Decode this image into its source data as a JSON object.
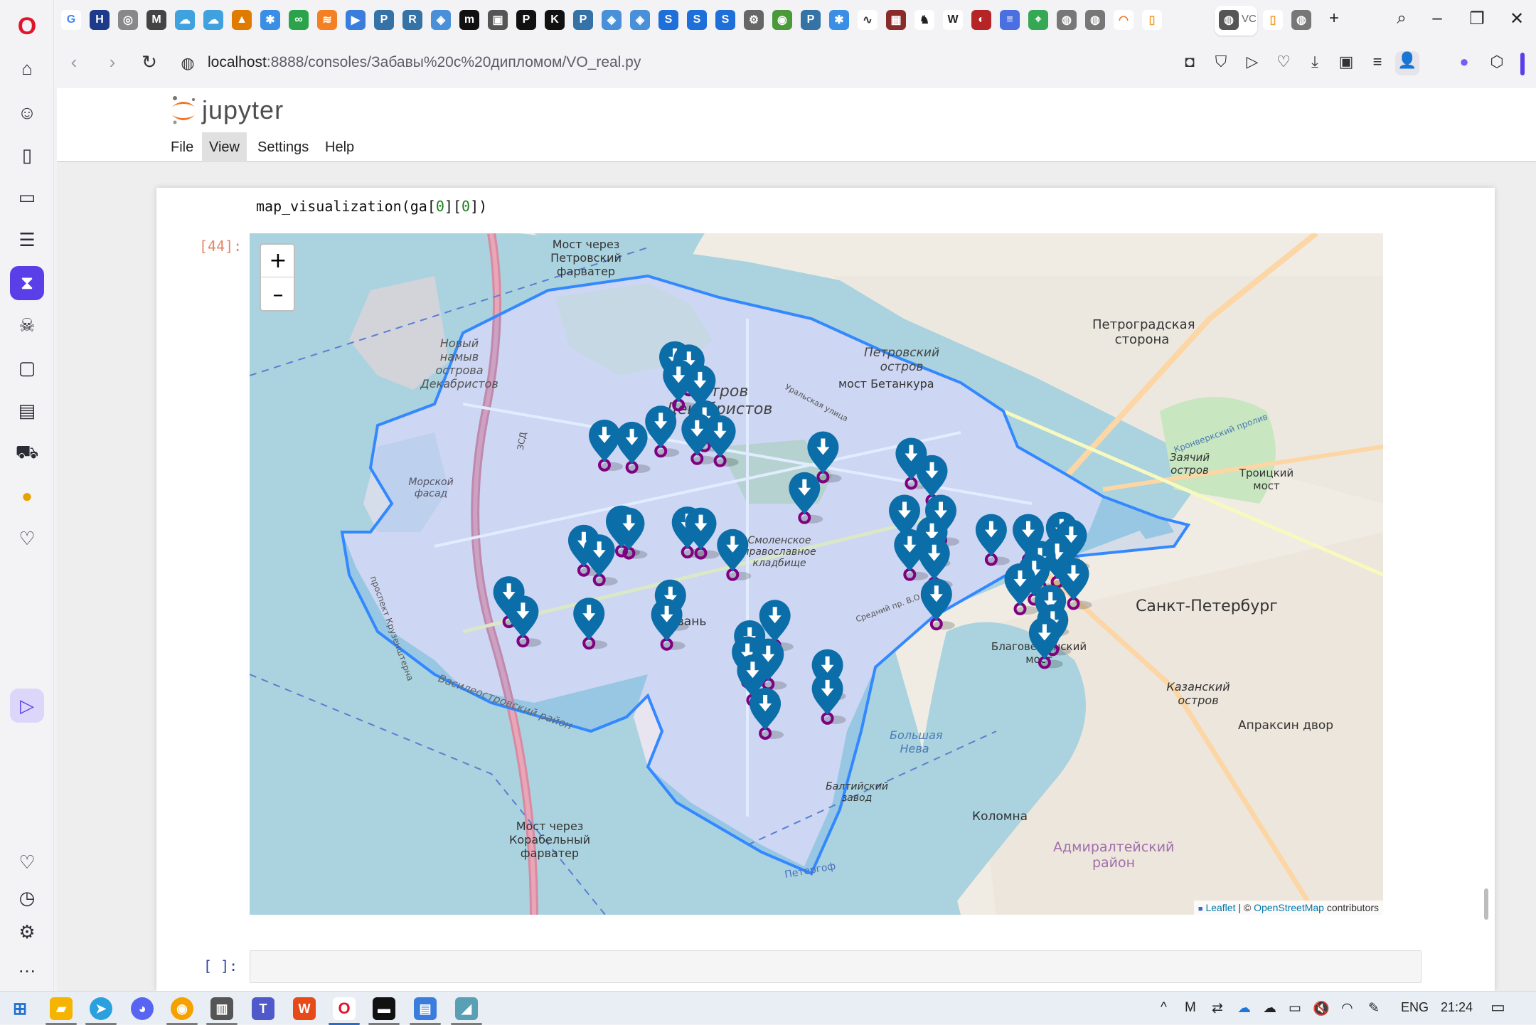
{
  "browser": {
    "url_host": "localhost",
    "url_path": ":8888/consoles/Забавы%20с%20дипломом/VO_real.py",
    "active_tab_label": "VC"
  },
  "jupyter": {
    "logo_text": "jupyter",
    "menu": [
      "File",
      "View",
      "Settings",
      "Help"
    ],
    "code_prefix": "map_visualization(ga[",
    "code_idx1": "0",
    "code_mid": "][",
    "code_idx2": "0",
    "code_suffix": "])",
    "out_prompt": "[44]:",
    "in_prompt": "[ ]:"
  },
  "map": {
    "zoom_in": "+",
    "zoom_out": "–",
    "attribution_leaflet": "Leaflet",
    "attribution_sep": " | © ",
    "attribution_osm": "OpenStreetMap",
    "attribution_tail": " contributors",
    "labels": [
      "Мост через Петровский фарватер",
      "Новый намыв острова Декабристов",
      "Остров Декабристов",
      "Петровский остров",
      "мост Бетанкура",
      "Петроградская сторона",
      "Заячий остров",
      "Троицкий мост",
      "Морской фасад",
      "Смоленское православное кладбище",
      "Санкт-Петербург",
      "Гавань",
      "Благовещенский мост",
      "Казанский остров",
      "Апраксин двор",
      "Большая Нева",
      "Балтийский завод",
      "Коломна",
      "Адмиралтейский район",
      "Мост через Корабельный фарватер",
      "Василеостровский район",
      "проспект Крузенштерна",
      "ЗСД",
      "Петергоф",
      "Уральская улица",
      "Средний пр. В.О.",
      "Кронверкский пролив"
    ],
    "markers": [
      {
        "lat": 59.9637,
        "lng": 30.2364
      },
      {
        "lat": 59.9634,
        "lng": 30.2383
      },
      {
        "lat": 59.962,
        "lng": 30.2369
      },
      {
        "lat": 59.9615,
        "lng": 30.2398
      },
      {
        "lat": 59.9577,
        "lng": 30.2345
      },
      {
        "lat": 59.9582,
        "lng": 30.2404
      },
      {
        "lat": 59.9564,
        "lng": 30.2269
      },
      {
        "lat": 59.9562,
        "lng": 30.2306
      },
      {
        "lat": 59.957,
        "lng": 30.2394
      },
      {
        "lat": 59.9568,
        "lng": 30.2425
      },
      {
        "lat": 59.9553,
        "lng": 30.2564
      },
      {
        "lat": 59.9547,
        "lng": 30.2683
      },
      {
        "lat": 59.9531,
        "lng": 30.2711
      },
      {
        "lat": 59.9515,
        "lng": 30.2539
      },
      {
        "lat": 59.9494,
        "lng": 30.2674
      },
      {
        "lat": 59.9494,
        "lng": 30.2723
      },
      {
        "lat": 59.9484,
        "lng": 30.2292
      },
      {
        "lat": 59.9482,
        "lng": 30.2302
      },
      {
        "lat": 59.9483,
        "lng": 30.2381
      },
      {
        "lat": 59.9482,
        "lng": 30.2399
      },
      {
        "lat": 59.9474,
        "lng": 30.2711
      },
      {
        "lat": 59.9476,
        "lng": 30.2791
      },
      {
        "lat": 59.9476,
        "lng": 30.2841
      },
      {
        "lat": 59.9478,
        "lng": 30.2886
      },
      {
        "lat": 59.9471,
        "lng": 30.2899
      },
      {
        "lat": 59.9466,
        "lng": 30.2241
      },
      {
        "lat": 59.9462,
        "lng": 30.2442
      },
      {
        "lat": 59.9462,
        "lng": 30.2681
      },
      {
        "lat": 59.9457,
        "lng": 30.2262
      },
      {
        "lat": 59.9454,
        "lng": 30.2714
      },
      {
        "lat": 59.9455,
        "lng": 30.288
      },
      {
        "lat": 59.9451,
        "lng": 30.2857
      },
      {
        "lat": 59.9439,
        "lng": 30.2849
      },
      {
        "lat": 59.9435,
        "lng": 30.2902
      },
      {
        "lat": 59.943,
        "lng": 30.283
      },
      {
        "lat": 59.9418,
        "lng": 30.214
      },
      {
        "lat": 59.9415,
        "lng": 30.2358
      },
      {
        "lat": 59.9416,
        "lng": 30.2717
      },
      {
        "lat": 59.941,
        "lng": 30.2871
      },
      {
        "lat": 59.94,
        "lng": 30.2159
      },
      {
        "lat": 59.9398,
        "lng": 30.2248
      },
      {
        "lat": 59.9397,
        "lng": 30.2353
      },
      {
        "lat": 59.9396,
        "lng": 30.2499
      },
      {
        "lat": 59.9392,
        "lng": 30.2874
      },
      {
        "lat": 59.938,
        "lng": 30.2863
      },
      {
        "lat": 59.9377,
        "lng": 30.2465
      },
      {
        "lat": 59.9362,
        "lng": 30.2462
      },
      {
        "lat": 59.936,
        "lng": 30.249
      },
      {
        "lat": 59.935,
        "lng": 30.257
      },
      {
        "lat": 59.9345,
        "lng": 30.2469
      },
      {
        "lat": 59.9328,
        "lng": 30.257
      },
      {
        "lat": 59.9314,
        "lng": 30.2486
      }
    ]
  },
  "taskbar": {
    "lang": "ENG",
    "time": "21:24"
  }
}
